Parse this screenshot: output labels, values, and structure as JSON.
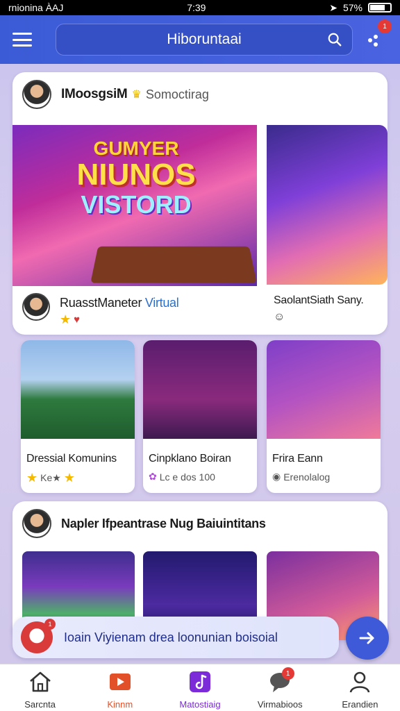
{
  "status_bar": {
    "carrier": "rnionina ÀAJ",
    "time": "7:39",
    "battery": "57%"
  },
  "header": {
    "search_text": "Hiboruntaai",
    "notif_count": "1"
  },
  "top_post": {
    "author": "IMoosgsiM",
    "subtitle": "Somoctirag",
    "banner_line1": "GUMYER",
    "banner_line2": "NIUNOS",
    "banner_line3": "VISTORD",
    "caption_main": "RuasstManeter",
    "caption_tag": "Virtual",
    "caption_side": "SaolantSiath Sany."
  },
  "tiles": [
    {
      "title": "Dressial Komunins",
      "meta": "Ke★"
    },
    {
      "title": "Cinpklano Boiran",
      "meta": "Lc e dos 100"
    },
    {
      "title": "Frira Eann",
      "meta": "Erenolalog"
    }
  ],
  "bottom_post": {
    "author": "Napler Ifpeantrase Nug Baiuintitans"
  },
  "chat": {
    "text": "Ioain Viyienam drea loonunian boisoial",
    "badge": "1"
  },
  "tabs": [
    {
      "label": "Sarcnta"
    },
    {
      "label": "Kinnm"
    },
    {
      "label": "Matostiaig"
    },
    {
      "label": "Virmabioos",
      "badge": "1"
    },
    {
      "label": "Erandien"
    }
  ],
  "colors": {
    "header": "#3b5bd6",
    "accent": "#3f5ad8",
    "active_tab": "#7b2bd8"
  }
}
